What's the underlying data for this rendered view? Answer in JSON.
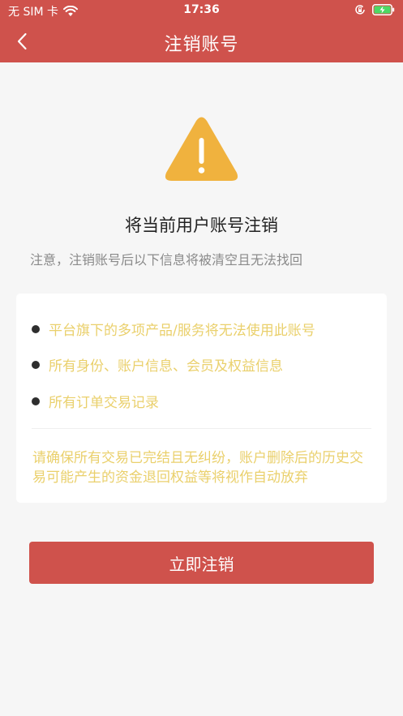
{
  "status_bar": {
    "carrier": "无 SIM 卡",
    "time": "17:36"
  },
  "nav": {
    "title": "注销账号",
    "back_icon": "chevron-left-icon"
  },
  "main": {
    "warning_icon": "warning-triangle-icon",
    "title": "将当前用户账号注销",
    "note": "注意，注销账号后以下信息将被清空且无法找回",
    "items": [
      {
        "text": "平台旗下的多项产品/服务将无法使用此账号"
      },
      {
        "text": "所有身份、账户信息、会员及权益信息"
      },
      {
        "text": "所有订单交易记录"
      }
    ],
    "card_note": "请确保所有交易已完结且无纠纷，账户删除后的历史交易可能产生的资金退回权益等将视作自动放弃",
    "confirm_button": "立即注销"
  },
  "colors": {
    "brand": "#cf524c",
    "warning": "#f0b23e",
    "highlight_text": "#ead06c"
  }
}
